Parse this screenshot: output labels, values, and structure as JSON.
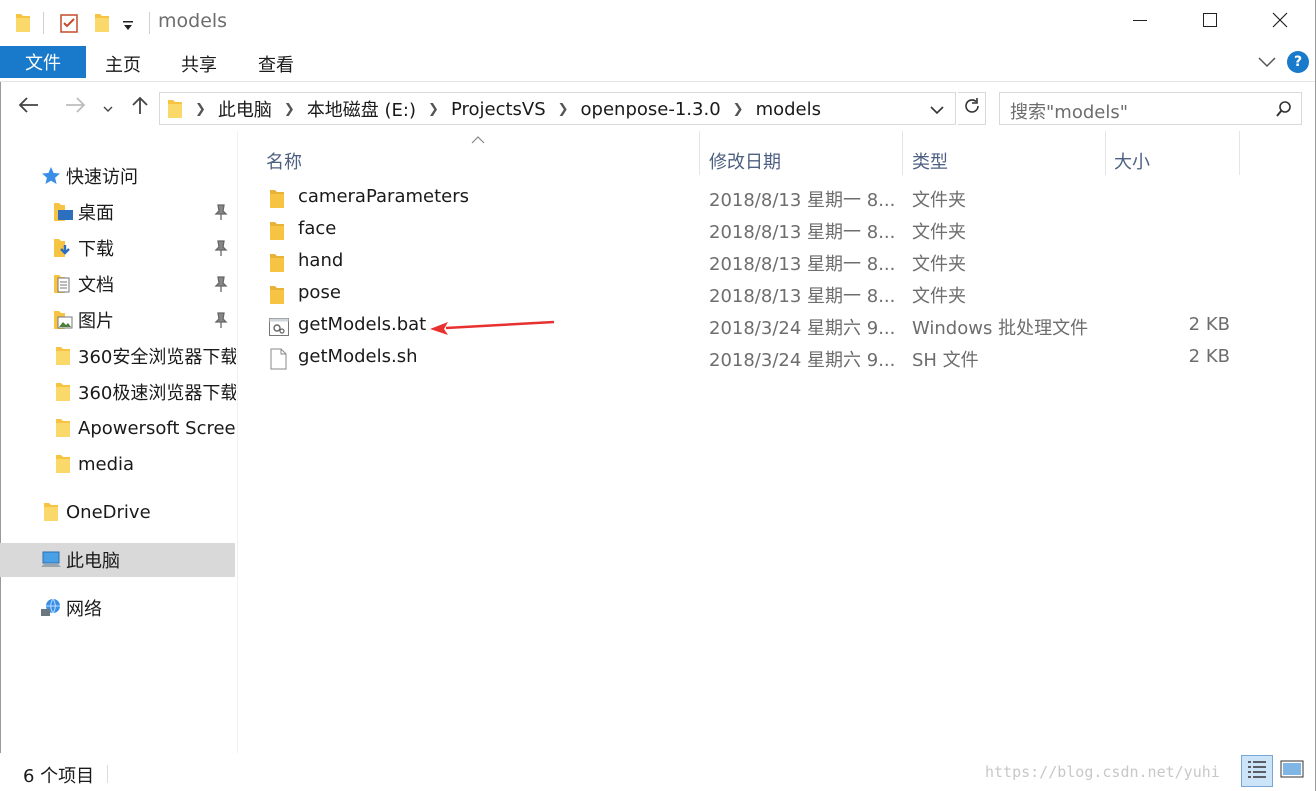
{
  "window": {
    "title": "models",
    "minimize_icon": "minimize-icon",
    "maximize_icon": "maximize-icon",
    "close_icon": "close-icon"
  },
  "ribbon": {
    "file_tab": "文件",
    "tabs": [
      "主页",
      "共享",
      "查看"
    ],
    "accent": "#1979ca",
    "help_label": "?"
  },
  "address": {
    "breadcrumbs": [
      "此电脑",
      "本地磁盘 (E:)",
      "ProjectsVS",
      "openpose-1.3.0",
      "models"
    ],
    "search_placeholder": "搜索\"models\""
  },
  "navpane": {
    "quick_access": "快速访问",
    "pinned": [
      "桌面",
      "下载",
      "文档",
      "图片"
    ],
    "recent": [
      "360安全浏览器下载",
      "360极速浏览器下载",
      "Apowersoft Screen",
      "media"
    ],
    "onedrive": "OneDrive",
    "this_pc": "此电脑",
    "network": "网络"
  },
  "columns": {
    "name": "名称",
    "date": "修改日期",
    "type": "类型",
    "size": "大小"
  },
  "files": [
    {
      "name": "cameraParameters",
      "date": "2018/8/13 星期一 8...",
      "type": "文件夹",
      "size": "",
      "icon": "folder-icon"
    },
    {
      "name": "face",
      "date": "2018/8/13 星期一 8...",
      "type": "文件夹",
      "size": "",
      "icon": "folder-icon"
    },
    {
      "name": "hand",
      "date": "2018/8/13 星期一 8...",
      "type": "文件夹",
      "size": "",
      "icon": "folder-icon"
    },
    {
      "name": "pose",
      "date": "2018/8/13 星期一 8...",
      "type": "文件夹",
      "size": "",
      "icon": "folder-icon"
    },
    {
      "name": "getModels.bat",
      "date": "2018/3/24 星期六 9...",
      "type": "Windows 批处理文件",
      "size": "2 KB",
      "icon": "batch-file-icon"
    },
    {
      "name": "getModels.sh",
      "date": "2018/3/24 星期六 9...",
      "type": "SH 文件",
      "size": "2 KB",
      "icon": "file-icon"
    }
  ],
  "status": {
    "count": "6 个项目",
    "watermark": "https://blog.csdn.net/yuhi"
  },
  "colors": {
    "folder": "#f6c342",
    "selection": "#d9d9d9",
    "header_text": "#4d6082",
    "annotation_arrow": "#e8302f"
  }
}
